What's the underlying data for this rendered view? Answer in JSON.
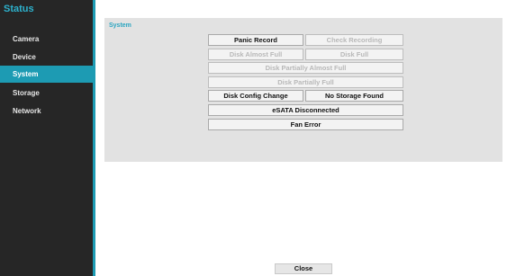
{
  "sidebar": {
    "title": "Status",
    "items": [
      {
        "label": "Camera"
      },
      {
        "label": "Device"
      },
      {
        "label": "System"
      },
      {
        "label": "Storage"
      },
      {
        "label": "Network"
      }
    ],
    "active_item": "System"
  },
  "panel": {
    "title": "System",
    "buttons": {
      "panic_record": "Panic Record",
      "check_recording": "Check Recording",
      "disk_almost_full": "Disk Almost Full",
      "disk_full": "Disk Full",
      "disk_partially_almost_full": "Disk Partially Almost Full",
      "disk_partially_full": "Disk Partially Full",
      "disk_config_change": "Disk Config Change",
      "no_storage_found": "No Storage Found",
      "esata_disconnected": "eSATA Disconnected",
      "fan_error": "Fan Error"
    }
  },
  "footer": {
    "close_label": "Close"
  },
  "colors": {
    "accent": "#1d9bb3",
    "sidebar_bg": "#262626",
    "panel_bg": "#e2e2e2",
    "disabled_text": "#b8b8b8"
  }
}
